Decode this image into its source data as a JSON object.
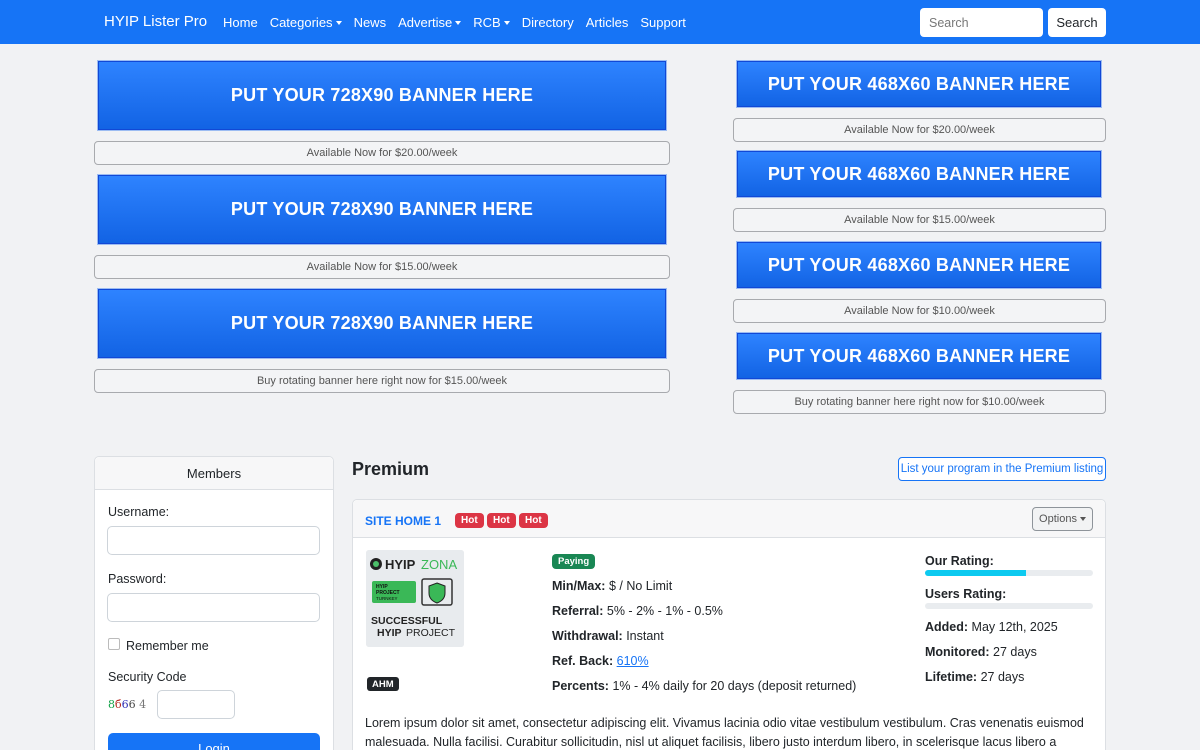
{
  "navbar": {
    "brand": "HYIP Lister Pro",
    "items": [
      {
        "label": "Home",
        "dropdown": false
      },
      {
        "label": "Categories",
        "dropdown": true
      },
      {
        "label": "News",
        "dropdown": false
      },
      {
        "label": "Advertise",
        "dropdown": true
      },
      {
        "label": "RCB",
        "dropdown": true
      },
      {
        "label": "Directory",
        "dropdown": false
      },
      {
        "label": "Articles",
        "dropdown": false
      },
      {
        "label": "Support",
        "dropdown": false
      }
    ],
    "search_placeholder": "Search",
    "search_button": "Search"
  },
  "banners_left": [
    {
      "label": "PUT YOUR 728X90 BANNER HERE",
      "caption": "Available Now for $20.00/week"
    },
    {
      "label": "PUT YOUR 728X90 BANNER HERE",
      "caption": "Available Now for $15.00/week"
    },
    {
      "label": "PUT YOUR 728X90 BANNER HERE",
      "caption": "Buy rotating banner here right now for $15.00/week"
    }
  ],
  "banners_right": [
    {
      "label": "PUT YOUR 468X60 BANNER HERE",
      "caption": "Available Now for $20.00/week"
    },
    {
      "label": "PUT YOUR 468X60 BANNER HERE",
      "caption": "Available Now for $15.00/week"
    },
    {
      "label": "PUT YOUR 468X60 BANNER HERE",
      "caption": "Available Now for $10.00/week"
    },
    {
      "label": "PUT YOUR 468X60 BANNER HERE",
      "caption": "Buy rotating banner here right now for $10.00/week"
    }
  ],
  "members": {
    "title": "Members",
    "username_label": "Username:",
    "password_label": "Password:",
    "remember_label": "Remember me",
    "security_label": "Security Code",
    "captcha": [
      "8",
      "б",
      "6",
      "6",
      "4"
    ],
    "login_button": "Login"
  },
  "premium": {
    "title": "Premium",
    "list_button": "List your program in the Premium listing",
    "program": {
      "name": "SITE HOME 1",
      "badges": [
        "Hot",
        "Hot",
        "Hot"
      ],
      "options_button": "Options",
      "logo": {
        "brand_a": "HYIP",
        "brand_b": "ZONA",
        "tag_1": "HYIP",
        "tag_2": "PROJECT",
        "tag_3": "TURNKEY",
        "line_1": "SUCCESSFUL",
        "line_2a": "HYIP",
        "line_2b": "PROJECT"
      },
      "monitor_badge": "AHM",
      "status_badge": "Paying",
      "details": {
        "minmax_label": "Min/Max:",
        "minmax_value": " $ / No Limit",
        "referral_label": "Referral:",
        "referral_value": " 5% - 2% - 1% - 0.5%",
        "withdrawal_label": "Withdrawal:",
        "withdrawal_value": " Instant",
        "refback_label": "Ref. Back:",
        "refback_value": "610%",
        "percents_label": "Percents:",
        "percents_value": " 1% - 4% daily for 20 days (deposit returned)"
      },
      "our_rating_label": "Our Rating:",
      "our_rating": 0.6,
      "users_rating_label": "Users Rating:",
      "users_rating": 0,
      "added_label": "Added:",
      "added_value": " May 12th, 2025",
      "monitored_label": "Monitored:",
      "monitored_value": " 27 days",
      "lifetime_label": "Lifetime:",
      "lifetime_value": " 27 days",
      "description": "Lorem ipsum dolor sit amet, consectetur adipiscing elit. Vivamus lacinia odio vitae vestibulum vestibulum. Cras venenatis euismod malesuada. Nulla facilisi. Curabitur sollicitudin, nisl ut aliquet facilisis, libero justo interdum libero, in scelerisque lacus libero a metus."
    }
  },
  "colors": {
    "primary": "#1674f6",
    "danger": "#dc3545",
    "success": "#198754",
    "info": "#0dcaf0",
    "dark": "#212529"
  }
}
